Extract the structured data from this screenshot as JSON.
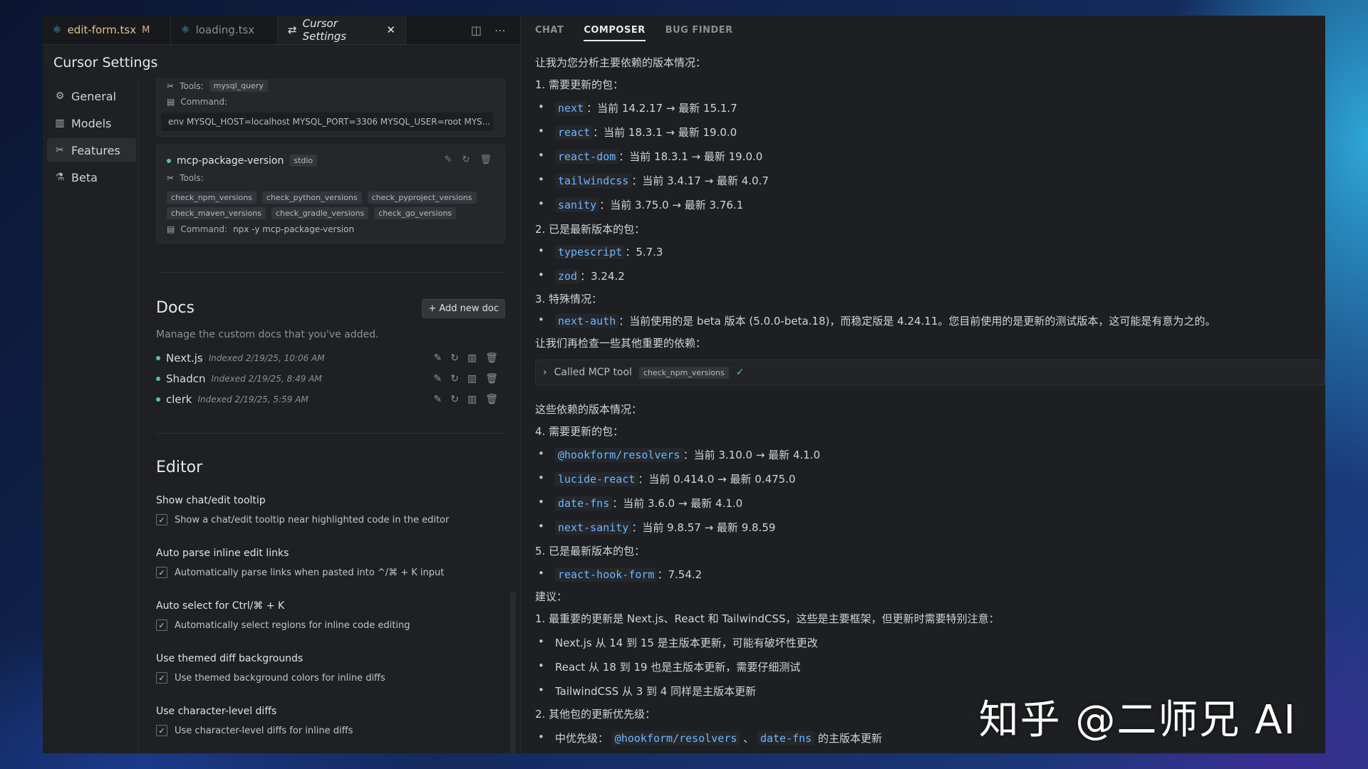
{
  "tabs": [
    {
      "name": "edit-form.tsx",
      "modified": "M"
    },
    {
      "name": "loading.tsx"
    },
    {
      "name": "Cursor Settings"
    }
  ],
  "settings": {
    "title": "Cursor Settings",
    "nav": [
      "General",
      "Models",
      "Features",
      "Beta"
    ]
  },
  "mcp": {
    "top_card": {
      "tools_label": "Tools:",
      "tool": "mysql_query",
      "command_label": "Command:",
      "command": "env MYSQL_HOST=localhost MYSQL_PORT=3306 MYSQL_USER=root MYS..."
    },
    "server": {
      "name": "mcp-package-version",
      "type": "stdio",
      "tools_label": "Tools:",
      "tools": [
        "check_npm_versions",
        "check_python_versions",
        "check_pyproject_versions",
        "check_maven_versions",
        "check_gradle_versions",
        "check_go_versions"
      ],
      "command_label": "Command:",
      "command": "npx -y mcp-package-version"
    }
  },
  "docs": {
    "title": "Docs",
    "add_label": "+ Add new doc",
    "desc": "Manage the custom docs that you've added.",
    "items": [
      {
        "name": "Next.js",
        "indexed": "Indexed 2/19/25, 10:06 AM"
      },
      {
        "name": "Shadcn",
        "indexed": "Indexed 2/19/25, 8:49 AM"
      },
      {
        "name": "clerk",
        "indexed": "Indexed 2/19/25, 5:59 AM"
      }
    ]
  },
  "editor": {
    "title": "Editor",
    "options": [
      {
        "title": "Show chat/edit tooltip",
        "desc": "Show a chat/edit tooltip near highlighted code in the editor"
      },
      {
        "title": "Auto parse inline edit links",
        "desc": "Automatically parse links when pasted into ^/⌘ + K input"
      },
      {
        "title": "Auto select for Ctrl/⌘ + K",
        "desc": "Automatically select regions for inline code editing"
      },
      {
        "title": "Use themed diff backgrounds",
        "desc": "Use themed background colors for inline diffs"
      },
      {
        "title": "Use character-level diffs",
        "desc": "Use character-level diffs for inline diffs"
      }
    ]
  },
  "right_tabs": [
    "CHAT",
    "COMPOSER",
    "BUG FINDER"
  ],
  "chat": {
    "intro": "让我为您分析主要依赖的版本情况：",
    "s1": "1. 需要更新的包：",
    "s1_items": [
      {
        "pkg": "next",
        "text": "：当前 14.2.17 → 最新 15.1.7"
      },
      {
        "pkg": "react",
        "text": "：当前 18.3.1 → 最新 19.0.0"
      },
      {
        "pkg": "react-dom",
        "text": "：当前 18.3.1 → 最新 19.0.0"
      },
      {
        "pkg": "tailwindcss",
        "text": "：当前 3.4.17 → 最新 4.0.7"
      },
      {
        "pkg": "sanity",
        "text": "：当前 3.75.0 → 最新 3.76.1"
      }
    ],
    "s2": "2. 已是最新版本的包：",
    "s2_items": [
      {
        "pkg": "typescript",
        "text": "：5.7.3"
      },
      {
        "pkg": "zod",
        "text": "：3.24.2"
      }
    ],
    "s3": "3. 特殊情况：",
    "s3_items": [
      {
        "pkg": "next-auth",
        "text": "：当前使用的是 beta 版本 (5.0.0-beta.18)，而稳定版是 4.24.11。您目前使用的是更新的测试版本，这可能是有意为之的。"
      }
    ],
    "check_more": "让我们再检查一些其他重要的依赖：",
    "tool_call": "Called MCP tool",
    "tool_name": "check_npm_versions",
    "check_mark": "✓",
    "other": "这些依赖的版本情况：",
    "s4": "4. 需要更新的包：",
    "s4_items": [
      {
        "pkg": "@hookform/resolvers",
        "text": "：当前 3.10.0 → 最新 4.1.0"
      },
      {
        "pkg": "lucide-react",
        "text": "：当前 0.414.0 → 最新 0.475.0"
      },
      {
        "pkg": "date-fns",
        "text": "：当前 3.6.0 → 最新 4.1.0"
      },
      {
        "pkg": "next-sanity",
        "text": "：当前 9.8.57 → 最新 9.8.59"
      }
    ],
    "s5": "5. 已是最新版本的包：",
    "s5_items": [
      {
        "pkg": "react-hook-form",
        "text": "：7.54.2"
      }
    ],
    "advice": "建议：",
    "a1": "1. 最重要的更新是 Next.js、React 和 TailwindCSS，这些是主要框架，但更新时需要特别注意：",
    "a1_items": [
      "Next.js 从 14 到 15 是主版本更新，可能有破坏性更改",
      "React 从 18 到 19 也是主版本更新，需要仔细测试",
      "TailwindCSS 从 3 到 4 同样是主版本更新"
    ],
    "a2": "2. 其他包的更新优先级：",
    "a2_item": {
      "prefix": "中优先级：",
      "pkg1": "@hookform/resolvers",
      "sep": "、",
      "pkg2": "date-fns",
      "suffix": " 的主版本更新"
    }
  },
  "watermark": "知乎 @二师兄 AI"
}
